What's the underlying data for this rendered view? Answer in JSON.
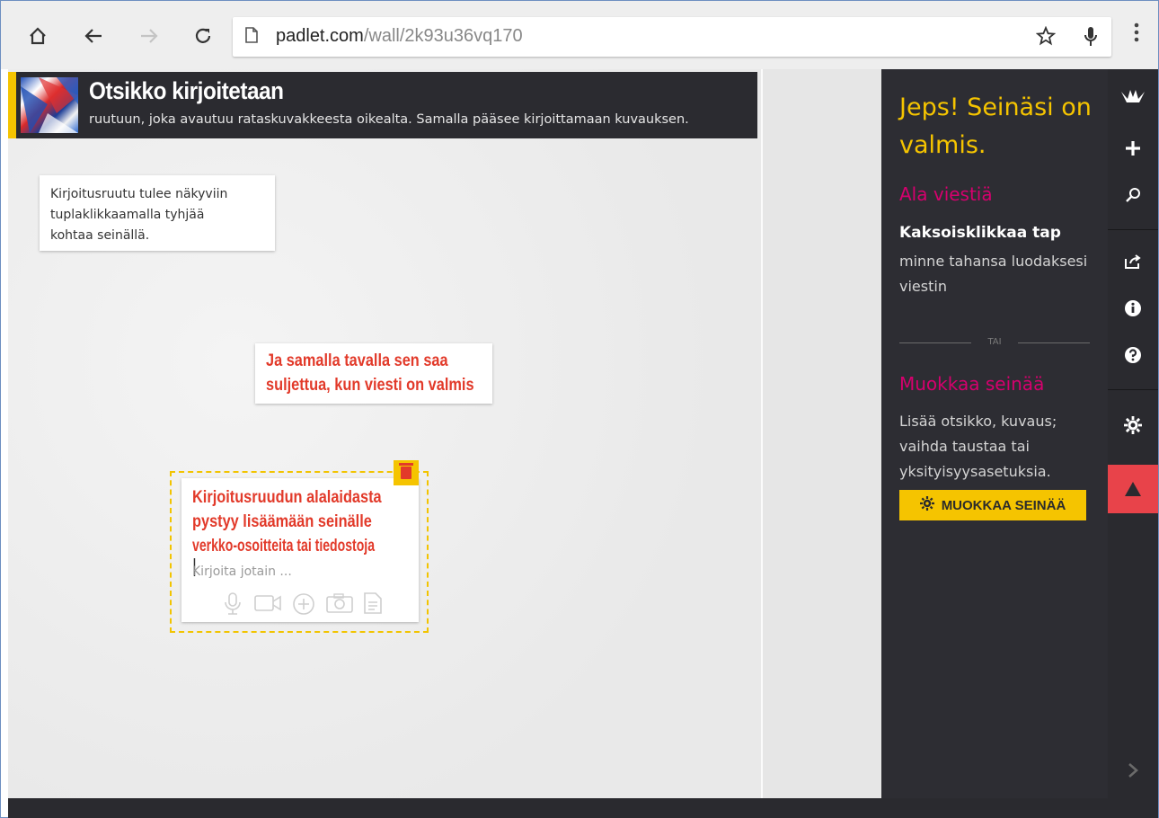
{
  "browser": {
    "url_host": "padlet.com",
    "url_path": "/wall/2k93u36vq170",
    "icons": [
      "home-icon",
      "back-icon",
      "forward-icon",
      "reload-icon",
      "page-icon",
      "star-icon",
      "mic-icon",
      "menu-icon"
    ]
  },
  "wall": {
    "title": "Otsikko kirjoitetaan",
    "description": "ruutuun, joka avautuu rataskuvakkeesta oikealta. Samalla pääsee kirjoittamaan kuvauksen.",
    "note1": {
      "lines": [
        "Kirjoitusruutu tulee näkyviin",
        "tuplaklikkaamalla tyhjää",
        "kohtaa seinällä."
      ]
    },
    "note2": {
      "lines": [
        "Ja samalla tavalla sen saa",
        "suljettua, kun viesti on valmis"
      ]
    },
    "editor": {
      "lines": [
        "Kirjoitusruudun alalaidasta",
        "pystyy lisäämään seinälle",
        "verkko-osoitteita tai tiedostoja"
      ],
      "placeholder": "Kirjoita jotain ...",
      "attach_icons": [
        "microphone-icon",
        "video-icon",
        "add-link-icon",
        "camera-icon",
        "document-icon"
      ]
    }
  },
  "sidebar": {
    "title": "Jeps! Seinäsi on valmis.",
    "start_heading": "Ala viestiä",
    "start_bold": "Kaksoisklikkaa tap",
    "start_text": "minne tahansa luodaksesi viestin",
    "or_label": "TAI",
    "edit_heading": "Muokkaa seinää",
    "edit_text": "Lisää otsikko, kuvaus; vaihda taustaa tai yksityisyysasetuksia.",
    "edit_button": "MUOKKAA SEINÄÄ"
  },
  "rail": {
    "icons": [
      "padlet-logo-icon",
      "plus-icon",
      "search-icon",
      "share-icon",
      "info-icon",
      "help-icon",
      "gear-icon",
      "alert-icon",
      "chevron-right-icon"
    ]
  },
  "colors": {
    "accent_yellow": "#f5c400",
    "magenta": "#d6006e",
    "note_red": "#e23a2a",
    "sidebar_bg": "#2d2d33"
  }
}
